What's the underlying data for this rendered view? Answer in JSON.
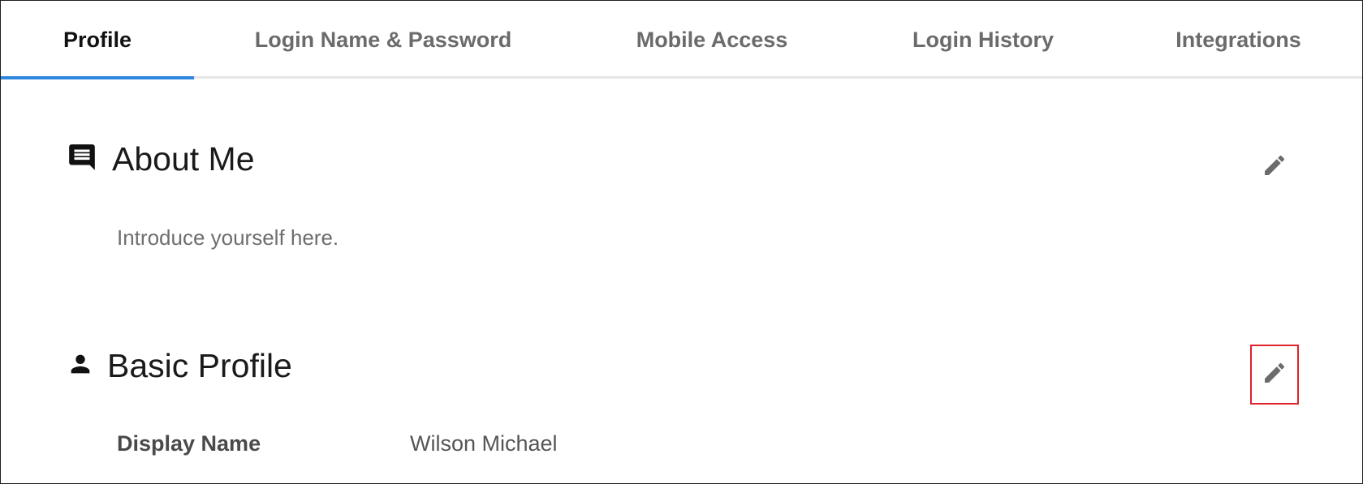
{
  "tabs": [
    {
      "label": "Profile",
      "active": true
    },
    {
      "label": "Login Name & Password",
      "active": false
    },
    {
      "label": "Mobile Access",
      "active": false
    },
    {
      "label": "Login History",
      "active": false
    },
    {
      "label": "Integrations",
      "active": false
    }
  ],
  "accent_color": "#2e86de",
  "focus_color": "#e0222b",
  "about_me": {
    "title": "About Me",
    "icon": "comment-icon",
    "placeholder": "Introduce yourself here.",
    "edit_icon": "pencil-icon"
  },
  "basic_profile": {
    "title": "Basic Profile",
    "icon": "person-icon",
    "edit_icon": "pencil-icon",
    "fields": [
      {
        "label": "Display Name",
        "value": "Wilson Michael"
      }
    ]
  }
}
